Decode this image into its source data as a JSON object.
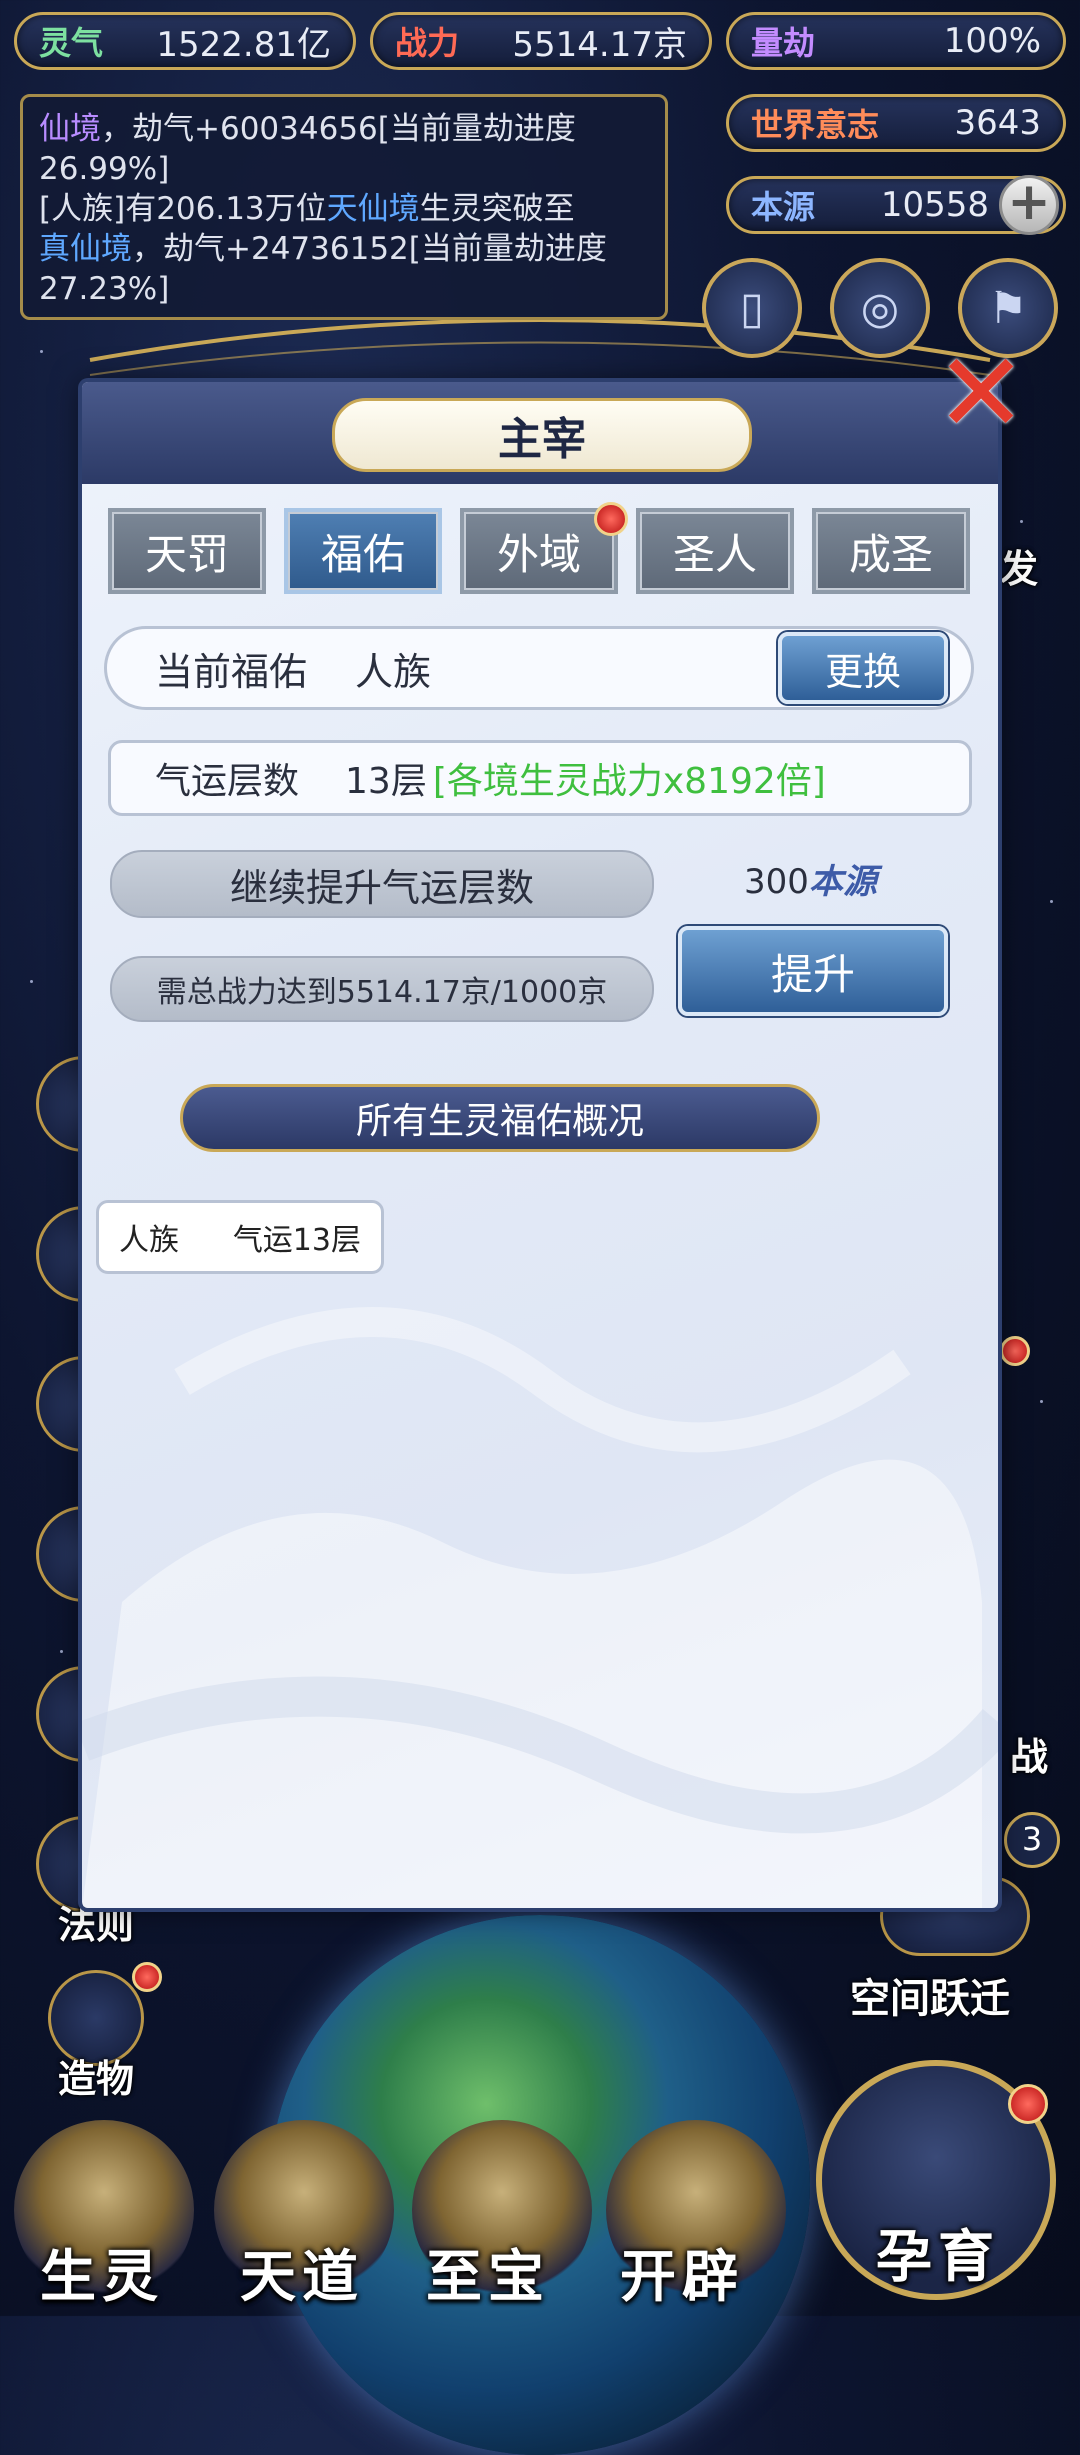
{
  "resources": {
    "lingqi": {
      "label": "灵气",
      "value": "1522.81亿",
      "color": "#7de0a0"
    },
    "zhanli": {
      "label": "战力",
      "value": "5514.17京",
      "color": "#ff6a55"
    },
    "liangjie": {
      "label": "量劫",
      "value": "100%",
      "color": "#c38cff"
    },
    "shijie": {
      "label": "世界意志",
      "value": "3643",
      "color": "#ff8c5a"
    },
    "benyuan": {
      "label": "本源",
      "value": "10558",
      "color": "#8db6ff"
    },
    "plus": "+"
  },
  "log": {
    "line1_a": "仙境",
    "line1_b": "，劫气+60034656[当前量劫进度26.99%]",
    "line2_a": "[人族]有206.13万位",
    "line2_b": "天仙境",
    "line2_c": "生灵突破至",
    "line2_d": "真仙境",
    "line2_e": "，劫气+24736152[当前量劫进度27.23%]"
  },
  "side_left": [
    {
      "label": "法则"
    },
    {
      "label": "造物"
    }
  ],
  "side_right": {
    "space_jump": "空间跃迁",
    "fa_fragment": "发",
    "zhan_fragment": "战",
    "count_badge": "3"
  },
  "bottom_nav": [
    "生灵",
    "天道",
    "至宝",
    "开辟",
    "孕育"
  ],
  "modal": {
    "title": "主宰",
    "tabs": [
      "天罚",
      "福佑",
      "外域",
      "圣人",
      "成圣"
    ],
    "active_tab": 1,
    "current_blessing_label": "当前福佑",
    "current_blessing_value": "人族",
    "change_button": "更换",
    "luck_label": "气运层数",
    "luck_value": "13层",
    "luck_bonus": "[各境生灵战力x8192倍]",
    "upgrade_label": "继续提升气运层数",
    "cost_value": "300",
    "cost_unit": "本源",
    "requirement": "需总战力达到5514.17京/1000京",
    "upgrade_button": "提升",
    "overview_banner": "所有生灵福佑概况",
    "overview": [
      {
        "race": "人族",
        "luck": "气运13层"
      }
    ]
  },
  "colors": {
    "gold_border": "#c9a857",
    "bonus_green": "#3fbf3f",
    "active_tab": "#3b6ea3",
    "red_dot": "#d21b1b"
  }
}
